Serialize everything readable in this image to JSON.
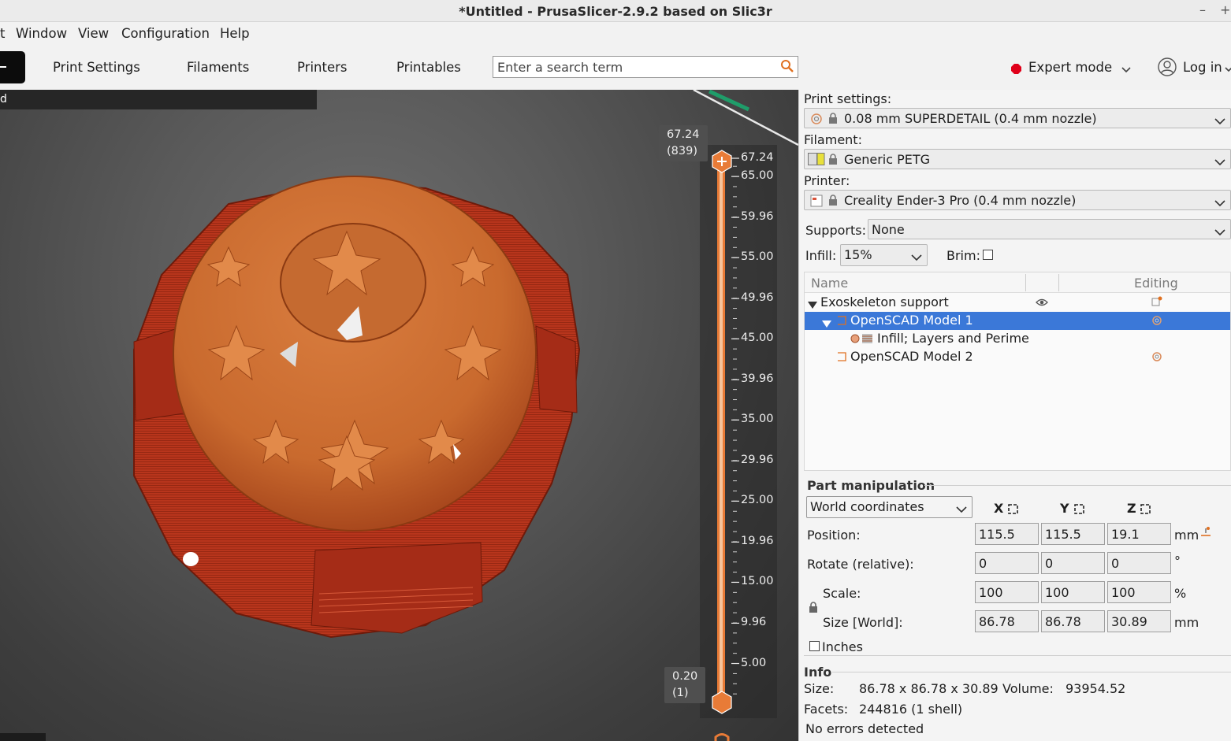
{
  "window": {
    "title": "*Untitled - PrusaSlicer-2.9.2 based on Slic3r",
    "minimize": "–",
    "maximize": "+"
  },
  "menu": {
    "file": "t",
    "window": "Window",
    "view": "View",
    "configuration": "Configuration",
    "help": "Help"
  },
  "tabs": {
    "print_settings": "Print Settings",
    "filaments": "Filaments",
    "printers": "Printers",
    "printables": "Printables"
  },
  "search": {
    "placeholder": "Enter a search term"
  },
  "mode": {
    "label": "Expert mode",
    "color": "#e0001a"
  },
  "login": {
    "label": "Log in"
  },
  "notification": {
    "text": "d"
  },
  "layer_slider": {
    "top_value": "67.24",
    "top_layer": "(839)",
    "bottom_value": "0.20",
    "bottom_layer": "(1)",
    "ticks": [
      "67.24",
      "65.00",
      "59.96",
      "55.00",
      "49.96",
      "45.00",
      "39.96",
      "35.00",
      "29.96",
      "25.00",
      "19.96",
      "15.00",
      "9.96",
      "5.00"
    ],
    "accent": "#e87b37"
  },
  "sidebar": {
    "print_settings_label": "Print settings:",
    "print_profile": "0.08 mm SUPERDETAIL (0.4 mm nozzle)",
    "filament_label": "Filament:",
    "filament_profile": "Generic PETG",
    "filament_color": "#e8e03a",
    "printer_label": "Printer:",
    "printer_profile": "Creality Ender-3 Pro (0.4 mm nozzle)",
    "supports_label": "Supports:",
    "supports_value": "None",
    "infill_label": "Infill:",
    "infill_value": "15%",
    "brim_label": "Brim:",
    "brim_checked": false
  },
  "object_list": {
    "col_name": "Name",
    "col_editing": "Editing",
    "rows": [
      {
        "label": "Exoskeleton support"
      },
      {
        "label": "OpenSCAD Model 1"
      },
      {
        "label": "Infill; Layers and Perime"
      },
      {
        "label": "OpenSCAD Model 2"
      }
    ],
    "selection_color": "#3b78d8"
  },
  "part_manipulation": {
    "title": "Part manipulation",
    "coord_system": "World coordinates",
    "axes": [
      "X",
      "Y",
      "Z"
    ],
    "position_label": "Position:",
    "position": [
      "115.5",
      "115.5",
      "19.1"
    ],
    "position_unit": "mm",
    "rotate_label": "Rotate (relative):",
    "rotate": [
      "0",
      "0",
      "0"
    ],
    "rotate_unit": "°",
    "scale_label": "Scale:",
    "scale": [
      "100",
      "100",
      "100"
    ],
    "scale_unit": "%",
    "size_label": "Size [World]:",
    "size": [
      "86.78",
      "86.78",
      "30.89"
    ],
    "size_unit": "mm",
    "inches_label": "Inches"
  },
  "info": {
    "title": "Info",
    "size_label": "Size:",
    "size_value": "86.78 x 86.78 x 30.89",
    "volume_label": "Volume:",
    "volume_value": "93954.52",
    "facets_label": "Facets:",
    "facets_value": "244816 (1 shell)",
    "errors": "No errors detected"
  }
}
